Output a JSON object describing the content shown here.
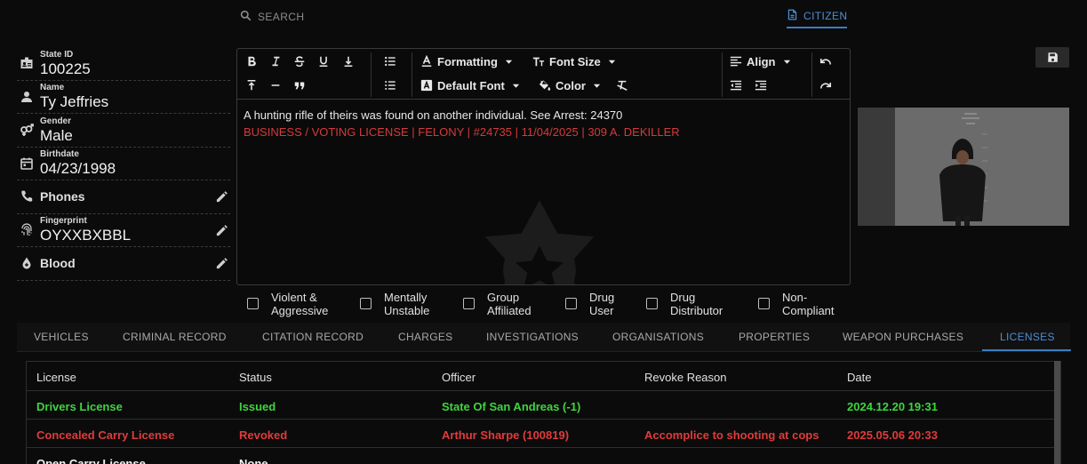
{
  "topbar": {
    "search_label": "SEARCH",
    "citizen_tab": "CITIZEN"
  },
  "profile": {
    "state_id": {
      "label": "State ID",
      "value": "100225"
    },
    "name": {
      "label": "Name",
      "value": "Ty Jeffries"
    },
    "gender": {
      "label": "Gender",
      "value": "Male"
    },
    "birthdate": {
      "label": "Birthdate",
      "value": "04/23/1998"
    },
    "phones": {
      "label": "Phones"
    },
    "fingerprint": {
      "label": "Fingerprint",
      "value": "OYXXBXBBL"
    },
    "blood": {
      "label": "Blood"
    }
  },
  "editor": {
    "toolbar": {
      "formatting": "Formatting",
      "font_size": "Font Size",
      "align": "Align",
      "default_font": "Default Font",
      "color": "Color"
    },
    "lines": [
      "A hunting rifle of theirs was found on another individual. See Arrest: 24370",
      "BUSINESS / VOTING LICENSE | FELONY | #24735 | 11/04/2025 | 309 A. DEKILLER"
    ]
  },
  "flags": [
    {
      "line1": "Violent &",
      "line2": "Aggressive",
      "checked": false
    },
    {
      "line1": "Mentally",
      "line2": "Unstable",
      "checked": false
    },
    {
      "line1": "Group",
      "line2": "Affiliated",
      "checked": false
    },
    {
      "line1": "Drug",
      "line2": "User",
      "checked": false
    },
    {
      "line1": "Drug",
      "line2": "Distributor",
      "checked": false
    },
    {
      "line1": "Non-",
      "line2": "Compliant",
      "checked": false
    }
  ],
  "tabs": [
    {
      "label": "VEHICLES"
    },
    {
      "label": "CRIMINAL RECORD"
    },
    {
      "label": "CITATION RECORD"
    },
    {
      "label": "CHARGES"
    },
    {
      "label": "INVESTIGATIONS"
    },
    {
      "label": "ORGANISATIONS"
    },
    {
      "label": "PROPERTIES"
    },
    {
      "label": "WEAPON PURCHASES"
    },
    {
      "label": "LICENSES",
      "active": true
    }
  ],
  "licenses": {
    "columns": [
      "License",
      "Status",
      "Officer",
      "Revoke Reason",
      "Date"
    ],
    "rows": [
      {
        "license": "Drivers License",
        "status": "Issued",
        "officer": "State Of San Andreas (-1)",
        "reason": "",
        "date": "2024.12.20 19:31",
        "color": "#3fd43f"
      },
      {
        "license": "Concealed Carry License",
        "status": "Revoked",
        "officer": "Arthur Sharpe (100819)",
        "reason": "Accomplice to shooting at cops",
        "date": "2025.05.06 20:33",
        "color": "#e03b3b"
      },
      {
        "license": "Open Carry License",
        "status": "None",
        "officer": "",
        "reason": "",
        "date": "",
        "color": "#f2f2f2"
      }
    ]
  },
  "colors": {
    "accent": "#4a8fd8",
    "issued": "#3fd43f",
    "revoked": "#e03b3b",
    "note_red": "#d63a3a"
  }
}
